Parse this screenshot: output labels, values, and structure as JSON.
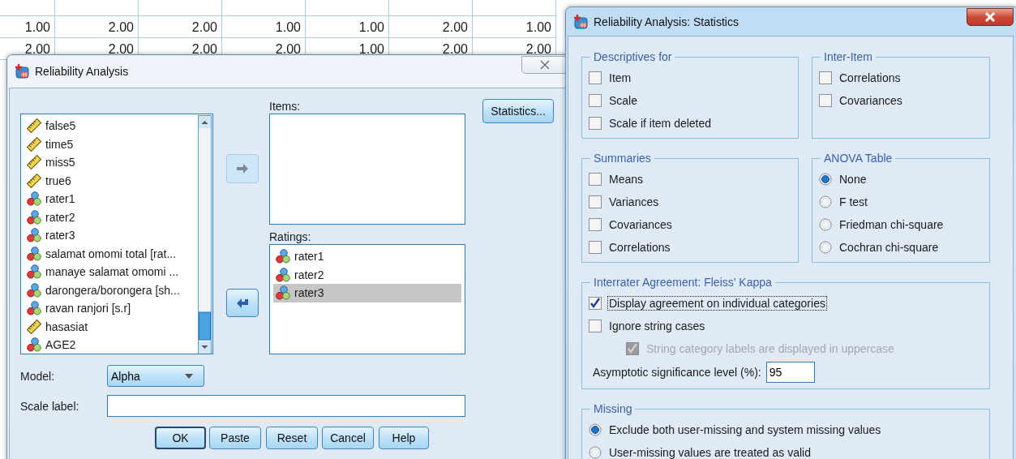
{
  "data_grid": {
    "rows": [
      [
        "1.00",
        "2.00",
        "2.00",
        "1.00",
        "1.00",
        "2.00",
        "1.00"
      ],
      [
        "2.00",
        "2.00",
        "2.00",
        "2.00",
        "1.00",
        "2.00",
        "2.00"
      ]
    ]
  },
  "reliability_dialog": {
    "title": "Reliability Analysis",
    "active": false,
    "variables": [
      {
        "name": "false5",
        "kind": "scale"
      },
      {
        "name": "time5",
        "kind": "scale"
      },
      {
        "name": "miss5",
        "kind": "scale"
      },
      {
        "name": "true6",
        "kind": "scale"
      },
      {
        "name": "rater1",
        "kind": "nominal"
      },
      {
        "name": "rater2",
        "kind": "nominal"
      },
      {
        "name": "rater3",
        "kind": "nominal"
      },
      {
        "name": "salamat omomi total [rat...",
        "kind": "nominal"
      },
      {
        "name": "manaye salamat omomi ...",
        "kind": "nominal"
      },
      {
        "name": "darongera/borongera [sh...",
        "kind": "nominal"
      },
      {
        "name": "ravan ranjori [s.r]",
        "kind": "nominal"
      },
      {
        "name": "hasasiat",
        "kind": "scale"
      },
      {
        "name": "AGE2",
        "kind": "nominal"
      }
    ],
    "arrow_buttons": [
      {
        "disabled": true
      },
      {
        "disabled": false
      }
    ],
    "items_label": "Items:",
    "ratings_label": "Ratings:",
    "ratings": [
      {
        "name": "rater1",
        "kind": "nominal",
        "selected": false
      },
      {
        "name": "rater2",
        "kind": "nominal",
        "selected": false
      },
      {
        "name": "rater3",
        "kind": "nominal",
        "selected": true
      }
    ],
    "statistics_button": "Statistics...",
    "model": {
      "label": "Model:",
      "value": "Alpha"
    },
    "scale_label": {
      "label": "Scale label:"
    },
    "buttons": [
      {
        "label": "OK",
        "default": true
      },
      {
        "label": "Paste",
        "default": false
      },
      {
        "label": "Reset",
        "default": false
      },
      {
        "label": "Cancel",
        "default": false
      },
      {
        "label": "Help",
        "default": false
      }
    ]
  },
  "statistics_dialog": {
    "title": "Reliability Analysis: Statistics",
    "active": true,
    "groups": [
      {
        "title": "Descriptives for",
        "options": [
          {
            "kind": "checkbox",
            "label": "Item",
            "checked": false
          },
          {
            "kind": "checkbox",
            "label": "Scale",
            "checked": false
          },
          {
            "kind": "checkbox",
            "label": "Scale if item deleted",
            "checked": false
          }
        ]
      },
      {
        "title": "Inter-Item",
        "options": [
          {
            "kind": "checkbox",
            "label": "Correlations",
            "checked": false
          },
          {
            "kind": "checkbox",
            "label": "Covariances",
            "checked": false
          }
        ]
      },
      {
        "title": "Summaries",
        "options": [
          {
            "kind": "checkbox",
            "label": "Means",
            "checked": false
          },
          {
            "kind": "checkbox",
            "label": "Variances",
            "checked": false
          },
          {
            "kind": "checkbox",
            "label": "Covariances",
            "checked": false
          },
          {
            "kind": "checkbox",
            "label": "Correlations",
            "checked": false
          }
        ]
      },
      {
        "title": "ANOVA Table",
        "options": [
          {
            "kind": "radio",
            "label": "None",
            "selected": true
          },
          {
            "kind": "radio",
            "label": "F test",
            "selected": false
          },
          {
            "kind": "radio",
            "label": "Friedman chi-square",
            "selected": false
          },
          {
            "kind": "radio",
            "label": "Cochran chi-square",
            "selected": false
          }
        ]
      },
      {
        "title": "Interrater Agreement: Fleiss' Kappa",
        "options": [
          {
            "kind": "checkbox",
            "label": "Display agreement on individual categories",
            "checked": true,
            "disabled": false,
            "focused": true
          },
          {
            "kind": "checkbox",
            "label": "Ignore string cases",
            "checked": false,
            "disabled": false,
            "focused": false
          },
          {
            "kind": "sub_checkbox",
            "label": "String category labels are displayed in uppercase",
            "checked": true,
            "disabled": true,
            "focused": false
          },
          {
            "kind": "field",
            "label": "Asymptotic significance level (%):",
            "value": "95",
            "disabled": false,
            "focused": false
          }
        ]
      },
      {
        "title": "Missing",
        "options": [
          {
            "kind": "radio",
            "label": "Exclude both user-missing and system missing values",
            "selected": true
          },
          {
            "kind": "radio",
            "label": "User-missing values are treated as valid",
            "selected": false
          }
        ]
      }
    ]
  }
}
